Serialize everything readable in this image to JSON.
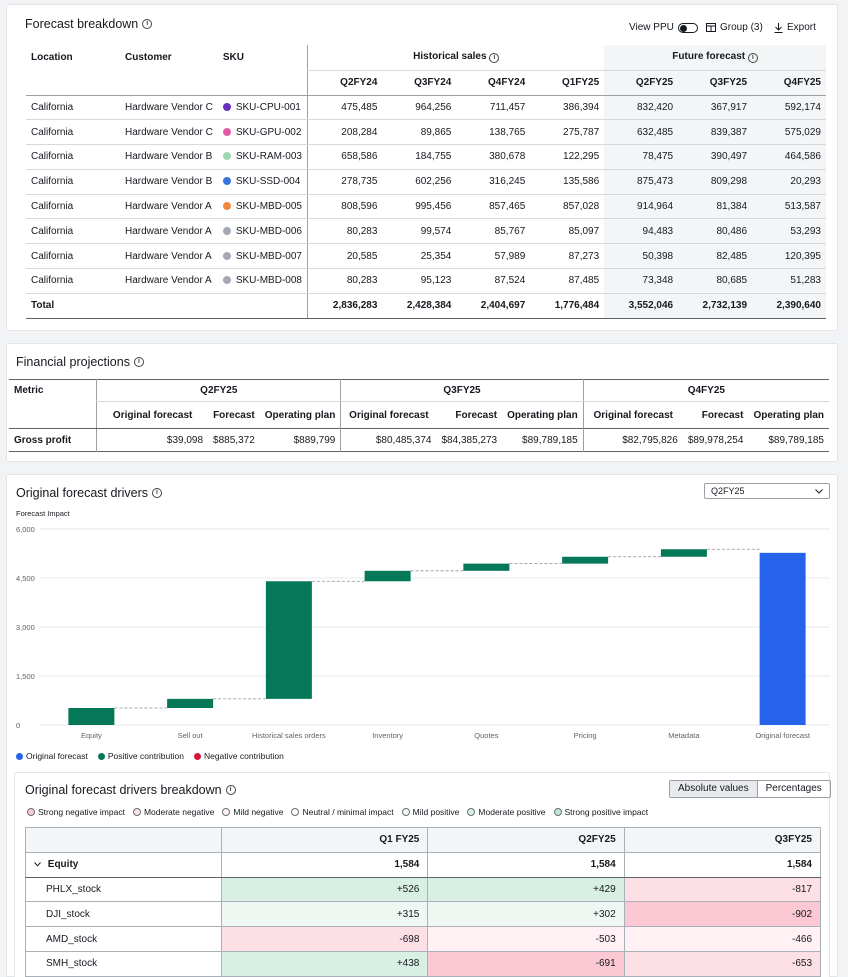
{
  "forecast_breakdown": {
    "title": "Forecast breakdown",
    "view_ppu": "View PPU",
    "group": "Group (3)",
    "export": "Export",
    "col_location": "Location",
    "col_customer": "Customer",
    "col_sku": "SKU",
    "group_historical": "Historical sales",
    "group_future": "Future forecast",
    "quarters": [
      "Q2FY24",
      "Q3FY24",
      "Q4FY24",
      "Q1FY25",
      "Q2FY25",
      "Q3FY25",
      "Q4FY25"
    ],
    "rows": [
      {
        "location": "California",
        "customer": "Hardware Vendor C",
        "sku": "SKU-CPU-001",
        "dot": "#6b2fbf",
        "values": [
          "475,485",
          "964,256",
          "711,457",
          "386,394",
          "832,420",
          "367,917",
          "592,174"
        ]
      },
      {
        "location": "California",
        "customer": "Hardware Vendor C",
        "sku": "SKU-GPU-002",
        "dot": "#e05aa8",
        "values": [
          "208,284",
          "89,865",
          "138,765",
          "275,787",
          "632,485",
          "839,387",
          "575,029"
        ]
      },
      {
        "location": "California",
        "customer": "Hardware Vendor B",
        "sku": "SKU-RAM-003",
        "dot": "#9fd8b0",
        "values": [
          "658,586",
          "184,755",
          "380,678",
          "122,295",
          "78,475",
          "390,497",
          "464,586"
        ]
      },
      {
        "location": "California",
        "customer": "Hardware Vendor B",
        "sku": "SKU-SSD-004",
        "dot": "#3a74e0",
        "values": [
          "278,735",
          "602,256",
          "316,245",
          "135,586",
          "875,473",
          "809,298",
          "20,293"
        ]
      },
      {
        "location": "California",
        "customer": "Hardware Vendor A",
        "sku": "SKU-MBD-005",
        "dot": "#f0883e",
        "values": [
          "808,596",
          "995,456",
          "857,465",
          "857,028",
          "914,964",
          "81,384",
          "513,587"
        ]
      },
      {
        "location": "California",
        "customer": "Hardware Vendor A",
        "sku": "SKU-MBD-006",
        "dot": "#a2a9b2",
        "values": [
          "80,283",
          "99,574",
          "85,767",
          "85,097",
          "94,483",
          "80,486",
          "53,293"
        ]
      },
      {
        "location": "California",
        "customer": "Hardware Vendor A",
        "sku": "SKU-MBD-007",
        "dot": "#a2a9b2",
        "values": [
          "20,585",
          "25,354",
          "57,989",
          "87,273",
          "50,398",
          "82,485",
          "120,395"
        ]
      },
      {
        "location": "California",
        "customer": "Hardware Vendor A",
        "sku": "SKU-MBD-008",
        "dot": "#a2a9b2",
        "values": [
          "80,283",
          "95,123",
          "87,524",
          "87,485",
          "73,348",
          "80,685",
          "51,283"
        ]
      }
    ],
    "total_label": "Total",
    "totals": [
      "2,836,283",
      "2,428,384",
      "2,404,697",
      "1,776,484",
      "3,552,046",
      "2,732,139",
      "2,390,640"
    ]
  },
  "financial": {
    "title": "Financial projections",
    "col_metric": "Metric",
    "quarters": [
      "Q2FY25",
      "Q3FY25",
      "Q4FY25"
    ],
    "sub_original": "Original forecast",
    "sub_forecast": "Forecast",
    "sub_plan": "Operating plan",
    "row_label": "Gross profit",
    "values": [
      "$39,098",
      "$885,372",
      "$889,799",
      "$80,485,374",
      "$84,385,273",
      "$89,789,185",
      "$82,795,826",
      "$89,978,254",
      "$89,789,185"
    ]
  },
  "drivers": {
    "title": "Original forecast drivers",
    "selected_quarter": "Q2FY25",
    "legend": [
      "Original forecast",
      "Positive contribution",
      "Negative contribution"
    ],
    "colors": {
      "original": "#2563eb",
      "positive": "#047857",
      "negative": "#d8143a"
    }
  },
  "chart_data": {
    "type": "bar",
    "subtype": "waterfall",
    "ylabel": "Forecast Impact",
    "ylim": [
      0,
      6000
    ],
    "yticks": [
      "0",
      "1,500",
      "3,000",
      "4,500",
      "6,000"
    ],
    "categories": [
      "Equity",
      "Sell out",
      "Historical sales orders",
      "Inventory",
      "Quotes",
      "Pricing",
      "Metadata",
      "Original forecast"
    ],
    "series": [
      {
        "name": "Positive contribution",
        "values": [
          520,
          280,
          3600,
          320,
          220,
          210,
          230,
          null
        ]
      },
      {
        "name": "Original forecast",
        "values": [
          null,
          null,
          null,
          null,
          null,
          null,
          null,
          5270
        ]
      }
    ]
  },
  "breakdown": {
    "title": "Original forecast drivers breakdown",
    "seg_absolute": "Absolute values",
    "seg_percent": "Percentages",
    "heat_legend": [
      {
        "label": "Strong negative impact",
        "color": "#fbc8d3"
      },
      {
        "label": "Moderate negative",
        "color": "#fde0e6"
      },
      {
        "label": "Mild negative",
        "color": "#fff1f4"
      },
      {
        "label": "Neutral / minimal impact",
        "color": "#ffffff"
      },
      {
        "label": "Mild positive",
        "color": "#eef7f2"
      },
      {
        "label": "Moderate positive",
        "color": "#d8efe3"
      },
      {
        "label": "Strong positive impact",
        "color": "#bfe5d0"
      }
    ],
    "columns": [
      "Q1 FY25",
      "Q2FY25",
      "Q3FY25"
    ],
    "group_label": "Equity",
    "group_values": [
      "1,584",
      "1,584",
      "1,584"
    ],
    "rows": [
      {
        "name": "PHLX_stock",
        "values": [
          "+526",
          "+429",
          "-817"
        ],
        "colors": [
          "#d8efe3",
          "#d8efe3",
          "#fde0e6"
        ]
      },
      {
        "name": "DJI_stock",
        "values": [
          "+315",
          "+302",
          "-902"
        ],
        "colors": [
          "#eef7f2",
          "#eef7f2",
          "#fbc8d3"
        ]
      },
      {
        "name": "AMD_stock",
        "values": [
          "-698",
          "-503",
          "-466"
        ],
        "colors": [
          "#fde0e6",
          "#fff1f4",
          "#fff1f4"
        ]
      },
      {
        "name": "SMH_stock",
        "values": [
          "+438",
          "-691",
          "-653"
        ],
        "colors": [
          "#d8efe3",
          "#fbc8d3",
          "#fde0e6"
        ]
      }
    ]
  }
}
